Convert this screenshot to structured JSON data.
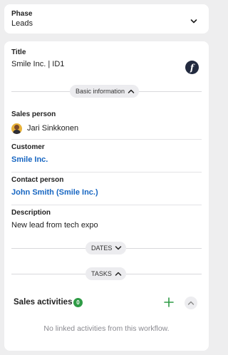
{
  "phase": {
    "label": "Phase",
    "value": "Leads",
    "icon": "chevron-down-icon"
  },
  "title": {
    "label": "Title",
    "value": "Smile Inc. | ID1",
    "function_icon": "f"
  },
  "basic_info": {
    "label": "Basic information",
    "icon": "chevron-up-icon"
  },
  "sales_person": {
    "label": "Sales person",
    "value": "Jari Sinkkonen"
  },
  "customer": {
    "label": "Customer",
    "value": "Smile Inc."
  },
  "contact_person": {
    "label": "Contact person",
    "value": "John Smith (Smile Inc.)"
  },
  "description": {
    "label": "Description",
    "value": "New lead from tech expo"
  },
  "dates": {
    "label": "DATES",
    "icon": "chevron-down-icon"
  },
  "tasks": {
    "label": "TASKS",
    "icon": "chevron-up-icon"
  },
  "sales_activities": {
    "title": "Sales activities",
    "count": "0",
    "empty_message": "No linked activities from this workflow."
  },
  "colors": {
    "link": "#1766c2",
    "badge": "#2e9b45",
    "plus": "#2e9b45",
    "function_button": "#222a3f"
  }
}
